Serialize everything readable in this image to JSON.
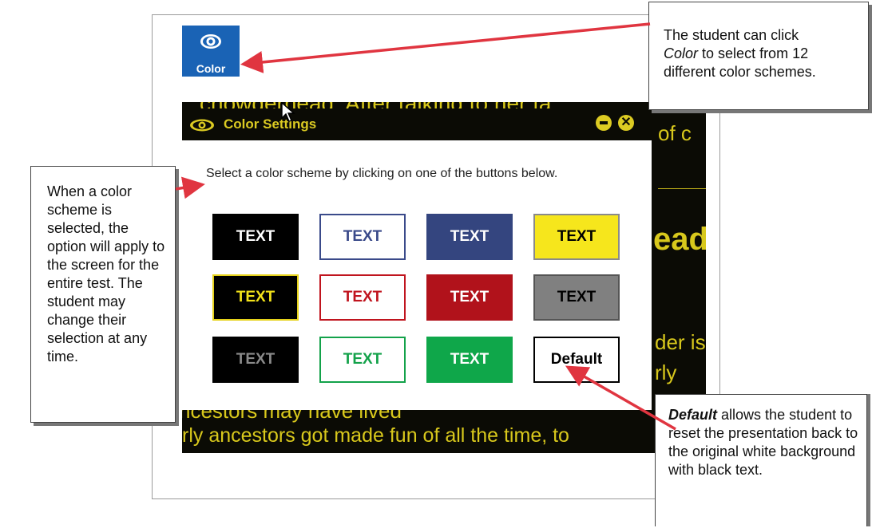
{
  "toolbar": {
    "color_label": "Color"
  },
  "background_text": {
    "line1": "chowderhead. After talking to her fa",
    "line2": "of c",
    "line3": "ead",
    "line4": "der is",
    "line5": "rly",
    "line6": "ncestors may have lived",
    "line7": "rly ancestors got made fun of all the time, to"
  },
  "dialog": {
    "title": "Color Settings",
    "instruction": "Select a color scheme by clicking on one of the buttons below.",
    "swatches": [
      {
        "label": "TEXT",
        "bg": "#000000",
        "fg": "#ffffff",
        "border": "#000000"
      },
      {
        "label": "TEXT",
        "bg": "#ffffff",
        "fg": "#3a4a8a",
        "border": "#3a4a8a"
      },
      {
        "label": "TEXT",
        "bg": "#34457f",
        "fg": "#ffffff",
        "border": "#34457f"
      },
      {
        "label": "TEXT",
        "bg": "#f6e61c",
        "fg": "#000000",
        "border": "#8a8a8a"
      },
      {
        "label": "TEXT",
        "bg": "#000000",
        "fg": "#f2e21a",
        "border": "#e6d21a"
      },
      {
        "label": "TEXT",
        "bg": "#ffffff",
        "fg": "#c0141e",
        "border": "#c0141e"
      },
      {
        "label": "TEXT",
        "bg": "#b1121b",
        "fg": "#ffffff",
        "border": "#b1121b"
      },
      {
        "label": "TEXT",
        "bg": "#808080",
        "fg": "#000000",
        "border": "#555555"
      },
      {
        "label": "TEXT",
        "bg": "#000000",
        "fg": "#8a8a8a",
        "border": "#000000"
      },
      {
        "label": "TEXT",
        "bg": "#ffffff",
        "fg": "#13a24a",
        "border": "#13a24a"
      },
      {
        "label": "TEXT",
        "bg": "#0fa74a",
        "fg": "#ffffff",
        "border": "#0fa74a"
      },
      {
        "label": "Default",
        "bg": "#ffffff",
        "fg": "#000000",
        "border": "#000000"
      }
    ]
  },
  "callouts": {
    "top_right_pre": "The student can click",
    "top_right_em": "Color",
    "top_right_post": "to select from 12 different color schemes.",
    "left": "When a color scheme is selected, the option will apply to the screen for the entire test. The student may change their selection at any time.",
    "bottom_right_em": "Default",
    "bottom_right_post": "allows the student to reset the presentation back to the original white background with black text."
  },
  "colors": {
    "accent_blue": "#1a63b5",
    "arrow_red": "#e03540",
    "dark_yellow": "#dccb22"
  }
}
